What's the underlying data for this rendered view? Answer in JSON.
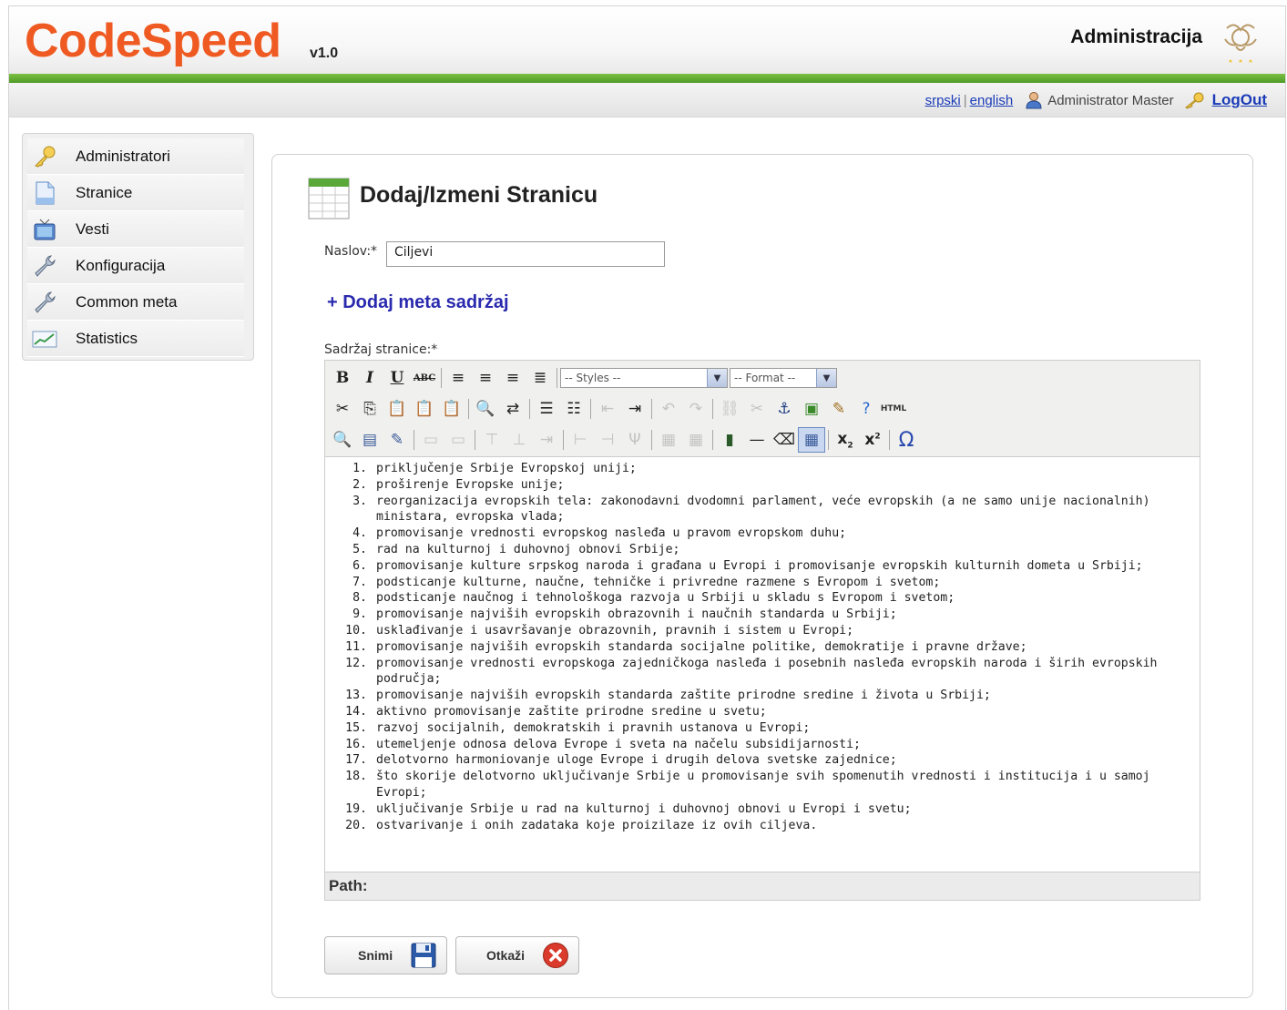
{
  "header": {
    "logo": "CodeSpeed",
    "version": "v1.0",
    "title": "Administracija"
  },
  "topbar": {
    "lang_sr": "srpski",
    "lang_sep": "|",
    "lang_en": "english",
    "user": "Administrator Master",
    "logout": "LogOut"
  },
  "sidebar": {
    "items": [
      {
        "label": "Administratori",
        "icon": "key-icon"
      },
      {
        "label": "Stranice",
        "icon": "page-icon"
      },
      {
        "label": "Vesti",
        "icon": "tv-icon"
      },
      {
        "label": "Konfiguracija",
        "icon": "wrench-icon"
      },
      {
        "label": "Common meta",
        "icon": "wrench-icon"
      },
      {
        "label": "Statistics",
        "icon": "chart-icon"
      }
    ]
  },
  "form": {
    "page_title": "Dodaj/Izmeni Stranicu",
    "title_label": "Naslov:*",
    "title_value": "Ciljevi",
    "meta_link": "+ Dodaj meta sadržaj",
    "content_label": "Sadržaj stranice:*"
  },
  "editor": {
    "styles_select": "-- Styles --",
    "format_select": "-- Format --",
    "path_label": "Path:",
    "items": [
      {
        "n": "1.",
        "text": "priključenje Srbije Evropskoj uniji;"
      },
      {
        "n": "2.",
        "text": "proširenje Evropske unije;"
      },
      {
        "n": "3.",
        "text": "reorganizacija evropskih tela: zakonodavni dvodomni parlament, veće evropskih (a ne samo unije nacionalnih) ministara, evropska vlada;"
      },
      {
        "n": "4.",
        "text": "promovisanje vrednosti evropskog nasleđa u pravom evropskom duhu;"
      },
      {
        "n": "5.",
        "text": "rad na kulturnoj i duhovnoj obnovi Srbije;"
      },
      {
        "n": "6.",
        "text": "promovisanje kulture srpskog naroda i građana u Evropi i promovisanje evropskih kulturnih dometa u Srbiji;"
      },
      {
        "n": "7.",
        "text": "podsticanje kulturne, naučne, tehničke i privredne razmene s Evropom i svetom;"
      },
      {
        "n": "8.",
        "text": "podsticanje naučnog i tehnološkoga razvoja u Srbiji u skladu s Evropom i svetom;"
      },
      {
        "n": "9.",
        "text": "promovisanje najviših evropskih obrazovnih i naučnih standarda u Srbiji;"
      },
      {
        "n": "10.",
        "text": "usklađivanje i usavršavanje obrazovnih, pravnih i sistem u Evropi;"
      },
      {
        "n": "11.",
        "text": "promovisanje najviših evropskih standarda socijalne politike, demokratije i pravne države;"
      },
      {
        "n": "12.",
        "text": "promovisanje vrednosti evropskoga zajedničkoga nasleđa i posebnih nasleđa evropskih naroda i širih evropskih područja;"
      },
      {
        "n": "13.",
        "text": "promovisanje najviših evropskih standarda zaštite prirodne sredine i života u Srbiji;"
      },
      {
        "n": "14.",
        "text": "aktivno promovisanje zaštite prirodne sredine u svetu;"
      },
      {
        "n": "15.",
        "text": "razvoj socijalnih, demokratskih i pravnih ustanova u Evropi;"
      },
      {
        "n": "16.",
        "text": "utemeljenje odnosa delova Evrope i sveta na načelu subsidijarnosti;"
      },
      {
        "n": "17.",
        "text": "delotvorno harmoniovanje uloge Evrope i drugih delova svetske zajednice;"
      },
      {
        "n": "18.",
        "text": "što skorije delotvorno uključivanje Srbije u promovisanje svih spomenutih vrednosti i institucija i u samoj Evropi;"
      },
      {
        "n": "19.",
        "text": "uključivanje Srbije u rad na kulturnoj i duhovnoj obnovi u Evropi i svetu;"
      },
      {
        "n": "20.",
        "text": "ostvarivanje i onih zadataka koje proizilaze iz ovih ciljeva."
      }
    ]
  },
  "buttons": {
    "save": "Snimi",
    "cancel": "Otkaži"
  },
  "colors": {
    "brand": "#ef5a22",
    "green_bar": "#5fa832",
    "link": "#1a3bb8",
    "meta_link": "#2a2aaf",
    "cancel_icon": "#d93a2b"
  }
}
